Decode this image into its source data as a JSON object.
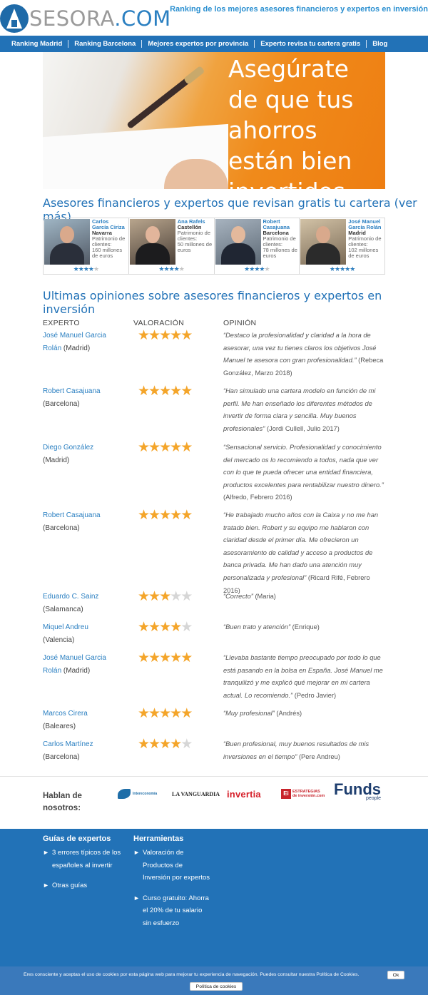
{
  "header": {
    "logo_text_main": "SESORA",
    "logo_text_dot": ".COM",
    "tagline": "Ranking de los mejores asesores financieros y expertos en inversión"
  },
  "nav": [
    "Ranking Madrid",
    "Ranking Barcelona",
    "Mejores expertos por provincia",
    "Experto revisa tu cartera gratis",
    "Blog"
  ],
  "hero": {
    "text": "Asegúrate de que tus ahorros están bien invertidos"
  },
  "advisors_section": {
    "title": "Asesores financieros y expertos que revisan gratis tu cartera (ver más)",
    "patrimonio_label": "Patrimonio de clientes:",
    "advisors": [
      {
        "name": "Carlos García Ciriza",
        "city": "Navarra",
        "amount": "160 millones de euros",
        "rating": 4
      },
      {
        "name": "Ana Rafels",
        "city": "Castellón",
        "amount": "50 millones de euros",
        "rating": 4
      },
      {
        "name": "Robert Casajuana",
        "city": "Barcelona",
        "amount": "78 millones de euros",
        "rating": 4
      },
      {
        "name": "José Manuel García Rolán",
        "city": "Madrid",
        "amount": "102 millones de euros",
        "rating": 4.5
      }
    ]
  },
  "reviews": {
    "title": "Ultimas opiniones sobre asesores financieros y expertos en inversión",
    "columns": [
      "EXPERTO",
      "VALORACIÓN",
      "OPINIÓN"
    ],
    "rows": [
      {
        "expert": "José Manuel Garcia Rolán",
        "location": "(Madrid)",
        "rating": 5,
        "quote": "“Destaco la profesionalidad y claridad a la hora de asesorar, una vez tu tienes claros los objetivos José Manuel te asesora con gran profesionalidad.”",
        "author": "(Rebeca González, Marzo 2018)"
      },
      {
        "expert": "Robert Casajuana",
        "location": "(Barcelona)",
        "rating": 5,
        "quote": "“Han simulado una cartera modelo en función de mi perfil. Me han enseñado los diferentes métodos de invertir de forma clara y sencilla. Muy buenos profesionales”",
        "author": "(Jordi Cullell, Julio 2017)"
      },
      {
        "expert": "Diego González",
        "location": "(Madrid)",
        "rating": 5,
        "quote": "“Sensacional servicio. Profesionalidad y conocimiento del mercado os lo recomiendo a todos, nada que ver con lo que te pueda ofrecer una entidad financiera, productos excelentes para rentabilizar nuestro dinero.”",
        "author": "(Alfredo, Febrero 2016)"
      },
      {
        "expert": "Robert Casajuana",
        "location": "(Barcelona)",
        "rating": 5,
        "quote": "“He trabajado mucho años con la Caixa y no me han tratado bien. Robert y su equipo me hablaron con claridad desde el primer día. Me ofrecieron un asesoramiento de calidad y acceso a productos de banca privada. Me han dado una atención muy personalizada y profesional”",
        "author": "(Ricard Rifé, Febrero 2016)"
      },
      {
        "expert": "Eduardo C. Sainz",
        "location": "(Salamanca)",
        "rating": 3,
        "quote": "“Correcto”",
        "author": "(Maria)"
      },
      {
        "expert": "Miquel Andreu",
        "location": "(Valencia)",
        "rating": 4,
        "quote": "“Buen trato y atención”",
        "author": "(Enrique)"
      },
      {
        "expert": "José Manuel Garcia Rolán",
        "location": "(Madrid)",
        "rating": 5,
        "quote": "“Llevaba bastante tiempo preocupado por todo lo que está pasando en la bolsa en España. José Manuel me tranquilizó y me explicó qué mejorar en mi cartera actual. Lo recomiendo.”",
        "author": "(Pedro Javier)"
      },
      {
        "expert": "Marcos Cirera",
        "location": "(Baleares)",
        "rating": 5,
        "quote": "“Muy profesional”",
        "author": "(Andrés)"
      },
      {
        "expert": "Carlos Martínez",
        "location": "(Barcelona)",
        "rating": 4,
        "quote": "“Buen profesional, muy buenos resultados de mis inversiones en el tiempo”",
        "author": "(Pere Andreu)"
      }
    ]
  },
  "press": {
    "label": "Hablan de nosotros:",
    "logos": {
      "intereconomia": "Intereconomía",
      "vanguardia": "LA VANGUARDIA",
      "invertia": "invertia",
      "estrategias_box": "Ei",
      "estrategias_1": "ESTRATEGIAS",
      "estrategias_2": "de inversión.com",
      "funds": "Funds",
      "funds_sub": "people"
    }
  },
  "footer": {
    "col1_title": "Guías de expertos",
    "col1_items": [
      "3 errores típicos de los españoles al invertir",
      "Otras guías"
    ],
    "col2_title": "Herramientas",
    "col2_items": [
      "Valoración de Productos de Inversión por expertos",
      "Curso gratuito: Ahorra el 20% de tu salario sin esfuerzo"
    ]
  },
  "cookie": {
    "text": "Eres consciente y aceptas el uso de cookies por esta página web para mejorar tu experiencia de navegación. Puedes consultar nuestra Política de Cookies.",
    "ok_label": "Ok",
    "policy_label": "Política de cookies"
  }
}
